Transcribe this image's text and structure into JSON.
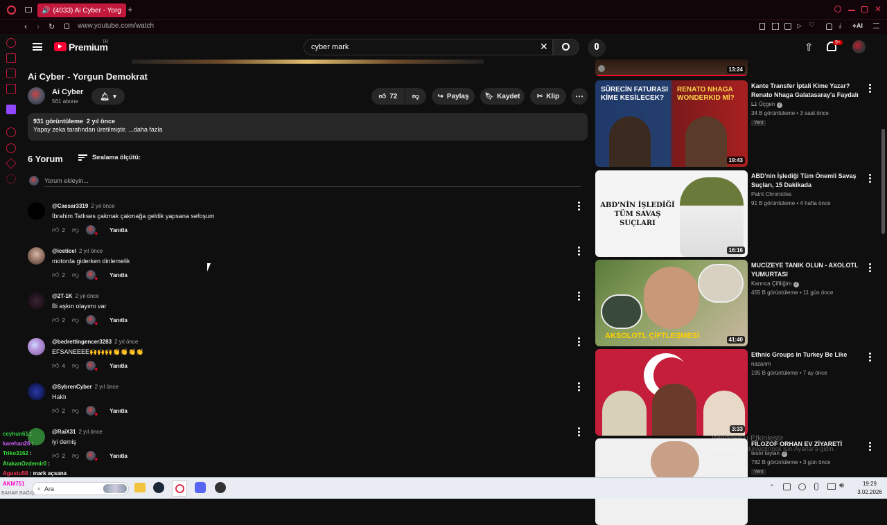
{
  "browser": {
    "tab_title": "(4033) Ai Cyber - Yorg",
    "url": "www.youtube.com/watch"
  },
  "header": {
    "logo_text": "Premium",
    "logo_region": "TR",
    "search_value": "cyber mark",
    "notif_count": "9+"
  },
  "video": {
    "title": "Ai Cyber - Yorgun Demokrat",
    "channel": "Ai Cyber",
    "subs": "561 abone",
    "likes": "72",
    "share": "Paylaş",
    "save": "Kaydet",
    "clip": "Klip",
    "views_date": "931 görüntüleme  2 yıl önce",
    "description": "Yapay zeka tarafından üretilmiştir. ...daha fazla"
  },
  "comments_section": {
    "count_label": "6 Yorum",
    "sort_label": "Sıralama ölçütü:",
    "add_placeholder": "Yorum ekleyin...",
    "reply_label": "Yanıtla",
    "items": [
      {
        "author": "@Caesar3319",
        "time": "2 yıl önce",
        "text": "İbrahim Tatlıses çakmak çakmağa geldik yapsana sefoşum",
        "likes": "2"
      },
      {
        "author": "@iceticel",
        "time": "2 yıl önce",
        "text": "motorda giderken dinlemelik",
        "likes": "2"
      },
      {
        "author": "@2T-1K",
        "time": "2 yıl önce",
        "text": "Bi aşkın olayımı var",
        "likes": "2"
      },
      {
        "author": "@bedrettingencer3283",
        "time": "2 yıl önce",
        "text": "EFSANEEEE🙌🙌🙌👏👏👏👏",
        "likes": "4"
      },
      {
        "author": "@SybrenCyber",
        "time": "2 yıl önce",
        "text": "Haklı",
        "likes": "2"
      },
      {
        "author": "@RaiX31",
        "time": "2 yıl önce",
        "text": "iyi demiş",
        "likes": "2"
      }
    ]
  },
  "sidebar": {
    "items": [
      {
        "title": "",
        "channel": "",
        "meta": "",
        "duration": "13:24",
        "badge": ""
      },
      {
        "title": "Kante Transfer İptali Kime Yazar? Renato Nhaga Galatasaray'a Faydalı ...",
        "channel": "L1 Üçgen",
        "meta": "34 B görüntüleme • 3 saat önce",
        "duration": "19:43",
        "badge": "Yeni",
        "thumb_left": "SÜRECİN FATURASI KİME KESİLECEK?",
        "thumb_right": "RENATO NHAGA WONDERKID Mİ?"
      },
      {
        "title": "ABD'nin İşlediği Tüm Önemli Savaş Suçları, 15 Dakikada",
        "channel": "Paint Chronicles",
        "meta": "91 B görüntüleme • 4 hafta önce",
        "duration": "16:16",
        "badge": "",
        "thumb_text": "ABD'NİN İŞLEDİĞİ TÜM SAVAŞ SUÇLARI"
      },
      {
        "title": "MUCİZEYE TANIK OLUN - AXOLOTL YUMURTASI",
        "channel": "Karınca Çiftliğim",
        "meta": "455 B görüntüleme • 11 gün önce",
        "duration": "41:40",
        "badge": "",
        "thumb_text": "AKSOLOTL ÇİFTLEŞMESİ"
      },
      {
        "title": "Ethnic Groups in Turkey Be Like",
        "channel": "nazanm",
        "meta": "195 B görüntüleme • 7 ay önce",
        "duration": "3:33",
        "badge": ""
      },
      {
        "title": "FİLOZOF ORHAN EV ZİYARETİ",
        "channel": "testo taylan",
        "meta": "782 B görüntüleme • 3 gün önce",
        "duration": "",
        "badge": "Yeni"
      }
    ]
  },
  "watermark": {
    "line1": "Windows'u Etkinleştir",
    "line2": "Windows'u etkinleştirmek için Ayarlar'a gidin."
  },
  "chat_overlay": [
    {
      "name": "ceyhun61",
      "text": ":"
    },
    {
      "name": "karehan26",
      "text": ":"
    },
    {
      "name": "Triko3162",
      "text": ":"
    },
    {
      "name": "AtakanOzdemir0",
      "text": ":"
    },
    {
      "name": "Agustu58",
      "text": ": mark açsana"
    }
  ],
  "taskbar": {
    "search": "Ara",
    "corner_label": "AKM751",
    "corner_sub": "BAHAR BAĞIŞ",
    "time": "19:29",
    "date": "3.02.2026"
  },
  "colors": {
    "yt_red": "#ff0033",
    "browser_accent": "#c2183c",
    "bg": "#0f0f0f"
  }
}
